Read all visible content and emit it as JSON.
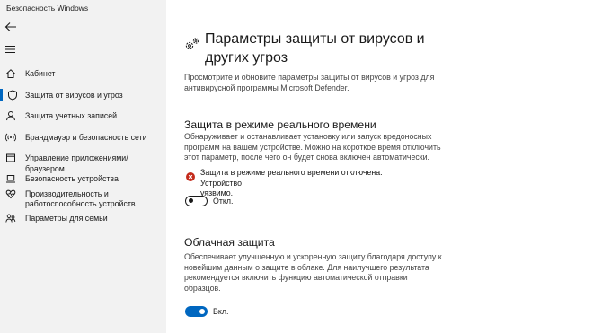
{
  "window": {
    "title": "Безопасность Windows"
  },
  "nav": {
    "back_icon": "back-arrow-icon",
    "menu_icon": "hamburger-menu-icon",
    "items": [
      {
        "label": "Кабинет",
        "icon": "home-icon"
      },
      {
        "label": "Защита от вирусов и угроз",
        "icon": "shield-icon",
        "selected": true
      },
      {
        "label": "Защита учетных записей",
        "icon": "person-icon"
      },
      {
        "label": "Брандмауэр и безопасность сети",
        "icon": "wifi-icon"
      },
      {
        "label": "Управление приложениями/браузером",
        "icon": "browser-icon"
      },
      {
        "label": "Безопасность устройства",
        "icon": "laptop-icon"
      },
      {
        "label_line1": "Производительность и",
        "label_line2": "работоспособность устройств",
        "icon": "heart-icon"
      },
      {
        "label": "Параметры для семьи",
        "icon": "family-icon"
      }
    ],
    "accent_color": "#0067c0"
  },
  "main": {
    "title_line1": "Параметры защиты от вирусов и",
    "title_line2": "других угроз",
    "description_line1": "Просмотрите и обновите параметры защиты от вирусов и угроз для",
    "description_line2": "антивирусной программы Microsoft Defender.",
    "realtime": {
      "title": "Защита в режиме реального времени",
      "desc_line1": "Обнаруживает и останавливает установку или запуск вредоносных",
      "desc_line2": "программ на вашем устройстве. Можно на короткое время отключить",
      "desc_line3": "этот параметр, после чего он будет снова включен автоматически.",
      "warning_line1": "Защита в режиме реального времени отключена. Устройство",
      "warning_line2": "уязвимо.",
      "warning_color": "#c42b1c",
      "toggle_state": "off",
      "toggle_label": "Откл."
    },
    "cloud": {
      "title": "Облачная защита",
      "desc_line1": "Обеспечивает улучшенную и ускоренную защиту благодаря доступу к",
      "desc_line2": "новейшим данным о защите в облаке. Для наилучшего результата",
      "desc_line3": "рекомендуется включить функцию автоматической отправки",
      "desc_line4": "образцов.",
      "toggle_state": "on",
      "toggle_label": "Вкл."
    }
  }
}
